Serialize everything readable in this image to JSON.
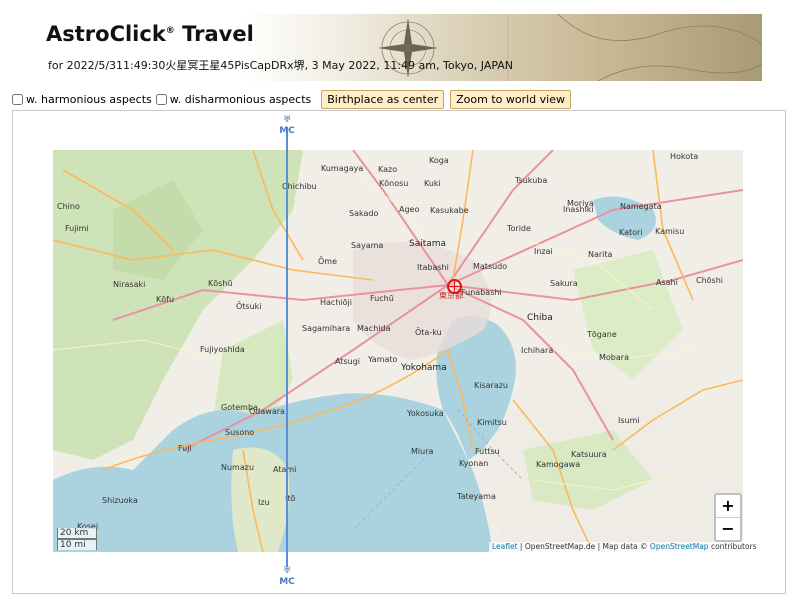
{
  "header": {
    "title": "AstroClick",
    "title_mark": "®",
    "title_suffix": " Travel",
    "subtitle": "for 2022/5/311:49:30火星冥王星45PisCapDRx堺, 3 May 2022, 11:49 am, Tokyo, JAPAN"
  },
  "controls": {
    "harmonious_label": "w. harmonious aspects",
    "harmonious_checked": false,
    "disharmonious_label": "w. disharmonious aspects",
    "disharmonious_checked": false,
    "birthplace_button": "Birthplace as center",
    "world_button": "Zoom to world view"
  },
  "map": {
    "mc_symbol": "♅",
    "mc_label": "MC",
    "zoom_in": "+",
    "zoom_out": "−",
    "scale_km": "20 km",
    "scale_mi": "10 mi",
    "attribution_leaflet": "Leaflet",
    "attribution_mid": " | OpenStreetMap.de | Map data © ",
    "attribution_osm": "OpenStreetMap",
    "attribution_end": " contributors",
    "places": [
      {
        "name": "Tokyo",
        "marker": "東京都"
      },
      {
        "name": "Tsukuba"
      },
      {
        "name": "Hokota"
      },
      {
        "name": "Kumagaya"
      },
      {
        "name": "Kazo"
      },
      {
        "name": "Koga"
      },
      {
        "name": "Kōnosu"
      },
      {
        "name": "Kuki"
      },
      {
        "name": "Sakado"
      },
      {
        "name": "Ageo"
      },
      {
        "name": "Kasukabe"
      },
      {
        "name": "Moriya"
      },
      {
        "name": "Toride"
      },
      {
        "name": "Inashiki"
      },
      {
        "name": "Namegata"
      },
      {
        "name": "Katori"
      },
      {
        "name": "Kamisu"
      },
      {
        "name": "Saitama"
      },
      {
        "name": "Sayama"
      },
      {
        "name": "Ōme"
      },
      {
        "name": "Itabashi"
      },
      {
        "name": "Matsudo"
      },
      {
        "name": "Inzai"
      },
      {
        "name": "Narita"
      },
      {
        "name": "Sakura"
      },
      {
        "name": "Asahi"
      },
      {
        "name": "Chōshi"
      },
      {
        "name": "Hachiōji"
      },
      {
        "name": "Fuchū"
      },
      {
        "name": "Funabashi"
      },
      {
        "name": "Chiba"
      },
      {
        "name": "Tōgane"
      },
      {
        "name": "Sagamihara"
      },
      {
        "name": "Machida"
      },
      {
        "name": "Ōta-ku"
      },
      {
        "name": "Ichihara"
      },
      {
        "name": "Mobara"
      },
      {
        "name": "Atsugi"
      },
      {
        "name": "Yamato"
      },
      {
        "name": "Yokohama"
      },
      {
        "name": "Kisarazu"
      },
      {
        "name": "Yokosuka"
      },
      {
        "name": "Miura"
      },
      {
        "name": "Kimitsu"
      },
      {
        "name": "Isumi"
      },
      {
        "name": "Futtsu"
      },
      {
        "name": "Kyonan"
      },
      {
        "name": "Kamogawa"
      },
      {
        "name": "Katsuura"
      },
      {
        "name": "Tateyama"
      },
      {
        "name": "Odawara"
      },
      {
        "name": "Chichibu"
      },
      {
        "name": "Nirasaki"
      },
      {
        "name": "Kōfu"
      },
      {
        "name": "Ōtsuki"
      },
      {
        "name": "Fujiyoshida"
      },
      {
        "name": "Gotemba"
      },
      {
        "name": "Susono"
      },
      {
        "name": "Fuji"
      },
      {
        "name": "Numazu"
      },
      {
        "name": "Atami"
      },
      {
        "name": "Itō"
      },
      {
        "name": "Izu"
      },
      {
        "name": "Shizuoka"
      },
      {
        "name": "Kosei"
      },
      {
        "name": "Chino"
      },
      {
        "name": "Fujimi"
      },
      {
        "name": "Kōshū"
      }
    ]
  }
}
